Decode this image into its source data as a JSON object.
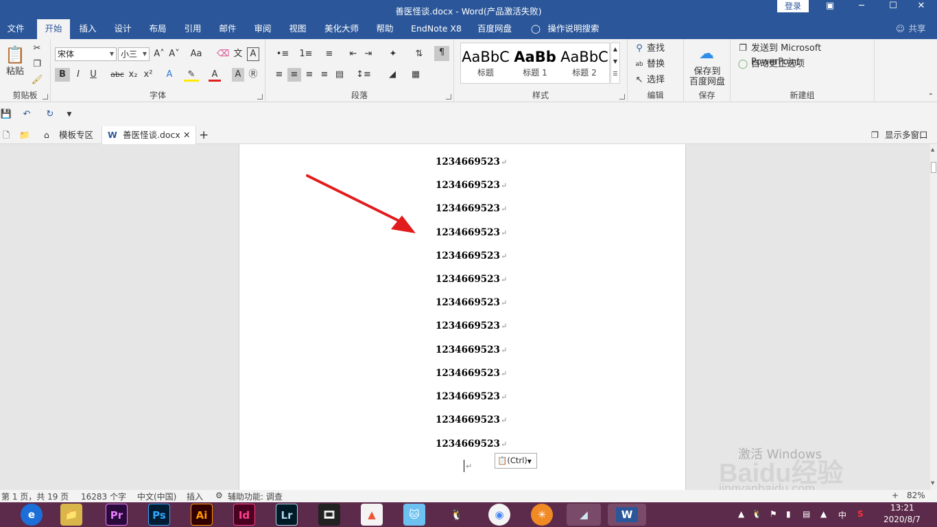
{
  "titlebar": {
    "title": "善医怪谈.docx  -  Word(产品激活失败)",
    "login": "登录",
    "restore_icon": "▣",
    "minimize_icon": "─",
    "maximize_icon": "☐",
    "close_icon": "✕"
  },
  "tabs": [
    {
      "label": "文件"
    },
    {
      "label": "开始"
    },
    {
      "label": "插入"
    },
    {
      "label": "设计"
    },
    {
      "label": "布局"
    },
    {
      "label": "引用"
    },
    {
      "label": "邮件"
    },
    {
      "label": "审阅"
    },
    {
      "label": "视图"
    },
    {
      "label": "美化大师"
    },
    {
      "label": "帮助"
    },
    {
      "label": "EndNote X8"
    },
    {
      "label": "百度网盘"
    },
    {
      "label": "操作说明搜索"
    },
    {
      "label": "共享"
    }
  ],
  "ribbon": {
    "clipboard": {
      "paste": "粘贴",
      "label": "剪贴板"
    },
    "font": {
      "name": "宋体",
      "size": "小三",
      "label": "字体",
      "grow": "A˄",
      "shrink": "A˅",
      "case": "Aa",
      "bold": "B",
      "italic": "I",
      "underline": "U",
      "strike": "abc",
      "sub": "x₂",
      "sup": "x²"
    },
    "paragraph": {
      "label": "段落"
    },
    "styles": {
      "label": "样式",
      "items": [
        {
          "sample": "AaBbC",
          "name": "标题"
        },
        {
          "sample": "AaBb",
          "name": "标题 1"
        },
        {
          "sample": "AaBbC",
          "name": "标题 2"
        }
      ]
    },
    "editing": {
      "find": "查找",
      "replace": "替换",
      "select": "选择",
      "label": "编辑"
    },
    "save": {
      "line1": "保存到",
      "line2": "百度网盘",
      "label": "保存"
    },
    "newgroup": {
      "send": "发送到 Microsoft PowerPoint",
      "autocorrect": "自动更正选项",
      "label": "新建组"
    }
  },
  "doctabs": {
    "template": "模板专区",
    "doc": "善医怪谈.docx",
    "multiwin": "显示多窗口"
  },
  "document": {
    "lines": [
      "1234669523",
      "1234669523",
      "1234669523",
      "1234669523",
      "1234669523",
      "1234669523",
      "1234669523",
      "1234669523",
      "1234669523",
      "1234669523",
      "1234669523",
      "1234669523",
      "1234669523"
    ],
    "paragraph_mark": "↵",
    "paste_label": "(Ctrl)"
  },
  "status": {
    "page": "第 1 页，共 19 页",
    "words": "16283 个字",
    "lang": "中文(中国)",
    "mode": "插入",
    "a11y": "辅助功能: 调查",
    "zoom": "82%"
  },
  "taskbar": {
    "apps": [
      {
        "label": "Pr",
        "color": "#2a0a3a",
        "fg": "#e77bff"
      },
      {
        "label": "Ps",
        "color": "#001d33",
        "fg": "#31a8ff"
      },
      {
        "label": "Ai",
        "color": "#330000",
        "fg": "#ff9a00"
      },
      {
        "label": "Id",
        "color": "#49021f",
        "fg": "#ff3f8f"
      },
      {
        "label": "Lr",
        "color": "#001a26",
        "fg": "#add5ec"
      }
    ],
    "time": "13:21",
    "date": "2020/8/7",
    "ime": "中"
  },
  "watermark": {
    "line1": "激活 Windows",
    "line2": "Baidu经验",
    "line3": "jingyanbaidu.com"
  },
  "colors": {
    "brand": "#2b579a",
    "taskbar": "#5c2a4a",
    "arrow": "#e21c1c"
  }
}
